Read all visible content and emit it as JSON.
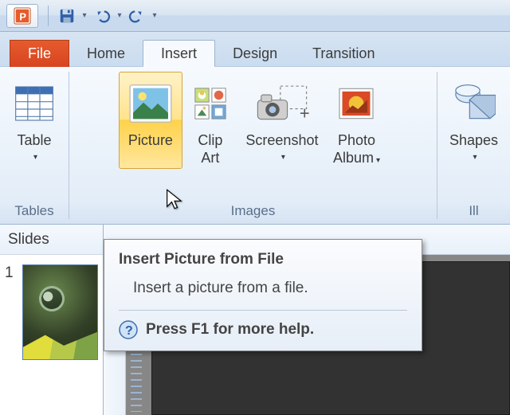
{
  "qat": {
    "save_name": "save-icon",
    "undo_name": "undo-icon",
    "redo_name": "redo-icon"
  },
  "tabs": {
    "file": "File",
    "home": "Home",
    "insert": "Insert",
    "design": "Design",
    "transitions": "Transition"
  },
  "ribbon": {
    "groups": {
      "tables": {
        "label": "Tables",
        "table_btn": "Table"
      },
      "images": {
        "label": "Images",
        "picture_btn": "Picture",
        "clipart_btn_l1": "Clip",
        "clipart_btn_l2": "Art",
        "screenshot_btn": "Screenshot",
        "album_btn_l1": "Photo",
        "album_btn_l2": "Album"
      },
      "illustrations": {
        "label": "Ill",
        "shapes_btn": "Shapes"
      }
    }
  },
  "slides": {
    "header": "Slides",
    "items": [
      {
        "num": "1"
      }
    ]
  },
  "tooltip": {
    "title": "Insert Picture from File",
    "body": "Insert a picture from a file.",
    "help": "Press F1 for more help."
  }
}
